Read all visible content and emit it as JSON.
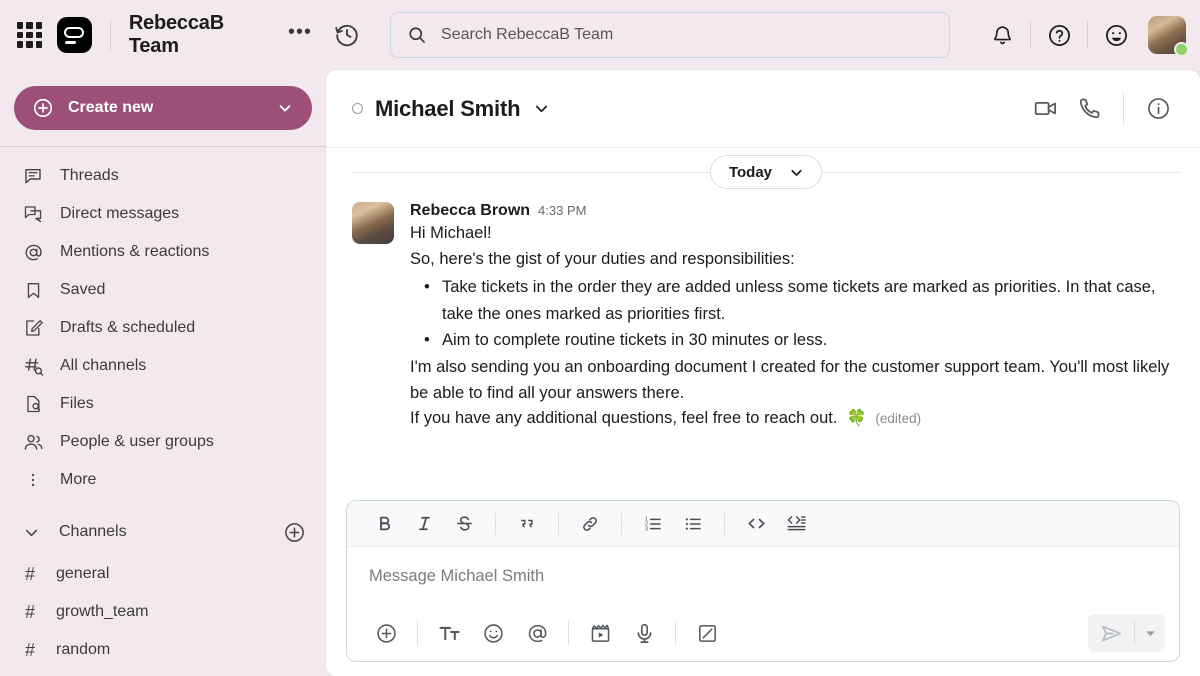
{
  "topbar": {
    "apps_icon": "grid-apps-icon",
    "logo_icon": "slack-logo-icon",
    "team_name": "RebeccaB Team",
    "more_label": "•••",
    "history_icon": "history-clock-icon",
    "search": {
      "icon": "search-icon",
      "placeholder": "Search RebeccaB Team",
      "value": ""
    },
    "notifications_icon": "bell-icon",
    "help_icon": "question-circle-icon",
    "emoji_icon": "smiley-face-icon",
    "avatar_name": "user-avatar",
    "presence": "active"
  },
  "sidebar": {
    "create_button": {
      "label": "Create new",
      "icon": "plus-circle-icon",
      "caret": "chevron-down-icon",
      "color": "#9C4F77"
    },
    "items": [
      {
        "label": "Threads",
        "icon": "threads-icon"
      },
      {
        "label": "Direct messages",
        "icon": "direct-messages-icon"
      },
      {
        "label": "Mentions & reactions",
        "icon": "at-mention-icon"
      },
      {
        "label": "Saved",
        "icon": "bookmark-icon"
      },
      {
        "label": "Drafts & scheduled",
        "icon": "draft-pencil-icon"
      },
      {
        "label": "All channels",
        "icon": "hash-search-icon"
      },
      {
        "label": "Files",
        "icon": "file-search-icon"
      },
      {
        "label": "People & user groups",
        "icon": "people-icon"
      },
      {
        "label": "More",
        "icon": "more-vertical-icon"
      }
    ],
    "channels_section": {
      "label": "Channels",
      "caret": "chevron-down-icon",
      "add_icon": "plus-circle-icon",
      "channels": [
        {
          "prefix": "#",
          "label": "general"
        },
        {
          "prefix": "#",
          "label": "growth_team"
        },
        {
          "prefix": "#",
          "label": "random"
        }
      ]
    }
  },
  "conversation": {
    "title": "Michael Smith",
    "status": "offline",
    "caret": "chevron-down-icon",
    "actions": {
      "video_icon": "video-camera-icon",
      "call_icon": "phone-icon",
      "info_icon": "info-circle-icon"
    },
    "day_divider": {
      "label": "Today",
      "caret": "chevron-down-icon"
    },
    "message": {
      "author": "Rebecca Brown",
      "time": "4:33 PM",
      "avatar": "rebecca-avatar",
      "greeting": "Hi Michael!",
      "intro": "So, here's the gist of your duties and responsibilities:",
      "bullets": [
        "Take tickets in the order they are added unless some tickets are marked as priorities. In that case, take the ones marked as priorities first.",
        "Aim to complete routine tickets in 30 minutes or less."
      ],
      "paragraph": "I'm also sending you an onboarding document I created for the customer support team. You'll most likely be able to find all your answers there.",
      "closing": "If you have any additional questions, feel free to reach out.",
      "emoji": "🍀",
      "edited_label": "(edited)"
    }
  },
  "composer": {
    "placeholder": "Message Michael Smith",
    "value": "",
    "format_buttons": [
      {
        "name": "bold-icon",
        "glyph": "B"
      },
      {
        "name": "italic-icon",
        "glyph": "I"
      },
      {
        "name": "strikethrough-icon",
        "glyph": "S"
      },
      {
        "name": "blockquote-icon",
        "glyph": "❞"
      },
      {
        "name": "link-icon",
        "glyph": "🔗"
      },
      {
        "name": "ordered-list-icon",
        "glyph": "1."
      },
      {
        "name": "bulleted-list-icon",
        "glyph": "•"
      },
      {
        "name": "code-icon",
        "glyph": "<>"
      },
      {
        "name": "code-block-icon",
        "glyph": "<>≡"
      }
    ],
    "action_buttons": [
      {
        "name": "attach-plus-icon"
      },
      {
        "name": "format-text-icon"
      },
      {
        "name": "emoji-icon"
      },
      {
        "name": "mention-icon"
      },
      {
        "name": "video-clip-icon"
      },
      {
        "name": "microphone-icon"
      },
      {
        "name": "canvas-icon"
      }
    ],
    "send_icon": "send-paperplane-icon",
    "send_caret": "chevron-down-icon"
  }
}
